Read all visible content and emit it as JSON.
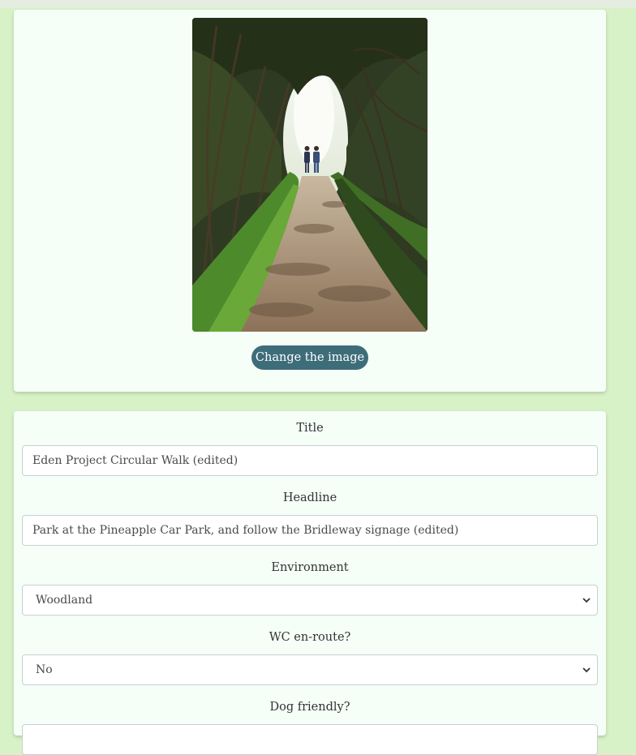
{
  "image_card": {
    "photo_alt": "Two walkers on a sunlit tree-tunnel footpath",
    "change_button_label": "Change the image"
  },
  "form": {
    "title": {
      "label": "Title",
      "value": "Eden Project Circular Walk (edited)"
    },
    "headline": {
      "label": "Headline",
      "value": "Park at the Pineapple Car Park, and follow the Bridleway signage (edited)"
    },
    "environment": {
      "label": "Environment",
      "selected": "Woodland"
    },
    "wc": {
      "label": "WC en-route?",
      "selected": "No"
    },
    "dog": {
      "label": "Dog friendly?"
    }
  },
  "colors": {
    "background": "#d8f2c8",
    "card": "#f5fff8",
    "button": "#3e6d7a"
  },
  "icons": {
    "select_chevron": "chevron-down-icon"
  }
}
